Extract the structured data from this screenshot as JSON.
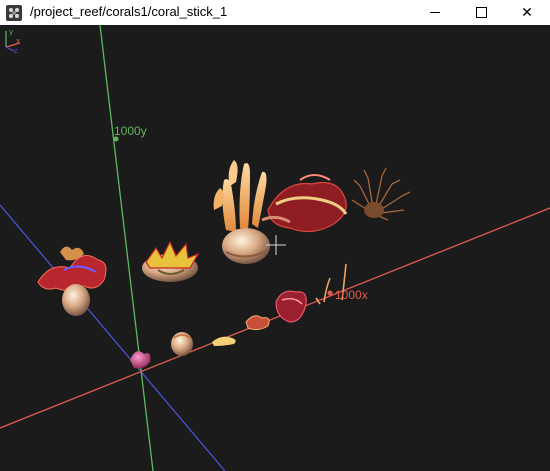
{
  "window": {
    "title": "/project_reef/corals1/coral_stick_1",
    "controls": {
      "minimize": "minimize",
      "maximize": "maximize",
      "close": "✕"
    }
  },
  "viewport": {
    "background": "#1b1b1b",
    "axes": {
      "y": {
        "label": "1000y",
        "color": "#5cb85c"
      },
      "x": {
        "label": "1000x",
        "color": "#e05a4f"
      },
      "z": {
        "color": "#4a52d6"
      }
    },
    "objects": [
      "coral-red-frilly",
      "coral-yellow-red",
      "coral-stick-orange",
      "coral-red-layered",
      "coral-brown-branching",
      "coral-pink-small",
      "coral-cream-round",
      "coral-yellow-fan",
      "coral-small-orange",
      "coral-red-mid",
      "coral-thin-orange"
    ],
    "crosshair": "crosshair-icon",
    "orientation_gizmo": "axis-gizmo-icon"
  }
}
